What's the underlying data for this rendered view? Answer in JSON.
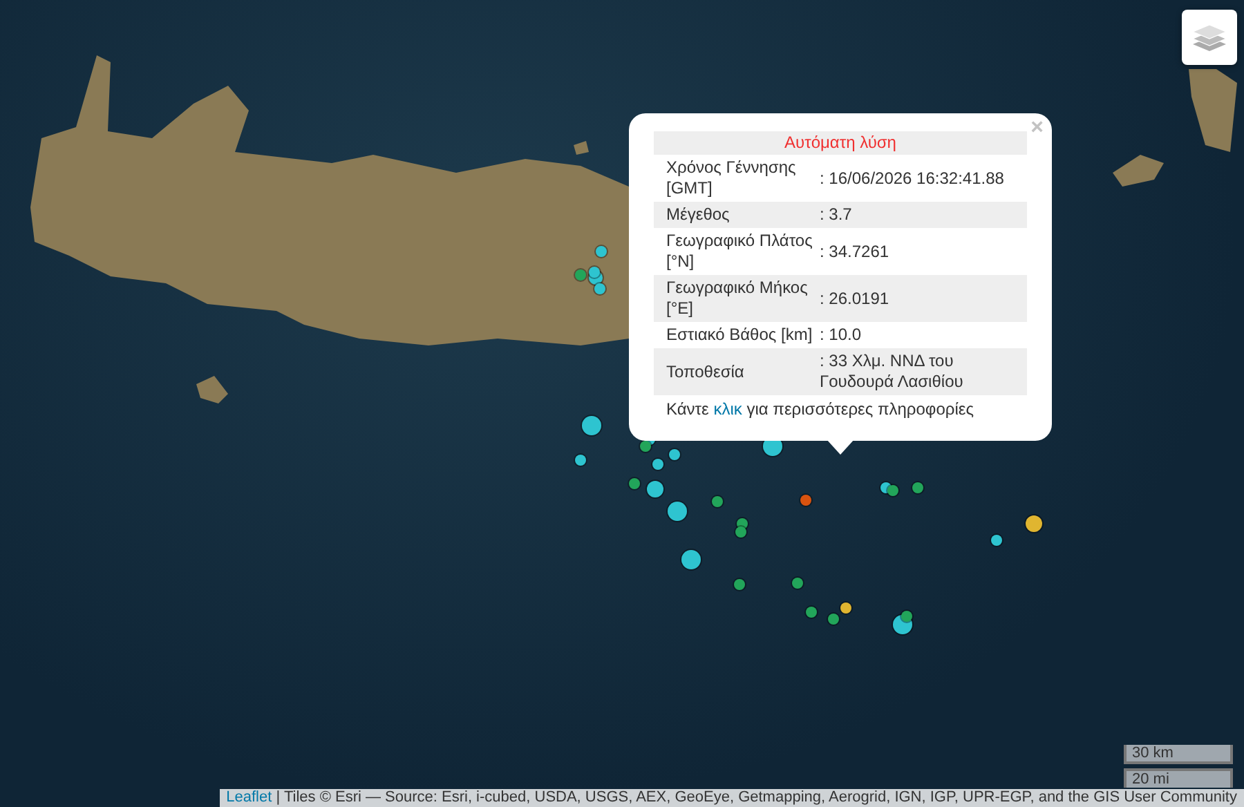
{
  "popup": {
    "title": "Αυτόματη λύση",
    "close": "×",
    "rows": [
      {
        "label": "Χρόνος Γέννησης [GMT]",
        "value": ": 16/06/2026 16:32:41.88"
      },
      {
        "label": "Μέγεθος",
        "value": ": 3.7"
      },
      {
        "label": "Γεωγραφικό Πλάτος [°N]",
        "value": ": 34.7261"
      },
      {
        "label": "Γεωγραφικό Μήκος [°E]",
        "value": ": 26.0191"
      },
      {
        "label": "Εστιακό Βάθος [km]",
        "value": ": 10.0"
      },
      {
        "label": "Τοποθεσία",
        "value": ": 33 Χλμ. ΝΝΔ του Γουδουρά Λασιθίου"
      }
    ],
    "footer": {
      "before": "Κάντε ",
      "link": "κλικ",
      "after": " για περισσότερες πληροφορίες"
    }
  },
  "markers": [
    {
      "color": "#2ec4d0"
    },
    {
      "color": "#2ec4d0"
    },
    {
      "color": "#2ec4d0"
    },
    {
      "color": "#2ec4d0"
    },
    {
      "color": "#2ec4d0"
    },
    {
      "color": "#2ec4d0"
    },
    {
      "color": "#2ec4d0"
    },
    {
      "color": "#2ec4d0"
    },
    {
      "color": "#2ec4d0"
    },
    {
      "color": "#2ec4d0"
    },
    {
      "color": "#2ec4d0"
    },
    {
      "color": "#2ec4d0"
    },
    {
      "color": "#2ec4d0"
    },
    {
      "color": "#2ec4d0"
    },
    {
      "color": "#2ec4d0"
    },
    {
      "color": "#2ec4d0"
    },
    {
      "color": "#22a55a"
    },
    {
      "color": "#22a55a"
    },
    {
      "color": "#22a55a"
    },
    {
      "color": "#22a55a"
    },
    {
      "color": "#22a55a"
    },
    {
      "color": "#22a55a"
    },
    {
      "color": "#22a55a"
    },
    {
      "color": "#22a55a"
    },
    {
      "color": "#22a55a"
    },
    {
      "color": "#22a55a"
    },
    {
      "color": "#22a55a"
    },
    {
      "color": "#22a55a"
    },
    {
      "color": "#22a55a"
    },
    {
      "color": "#d9530f"
    },
    {
      "color": "#e0b530"
    },
    {
      "color": "#e0b530"
    }
  ],
  "scale": [
    "30 km",
    "20 mi"
  ],
  "attribution": {
    "link": "Leaflet",
    "text": " | Tiles © Esri — Source: Esri, i-cubed, USDA, USGS, AEX, GeoEye, Getmapping, Aerogrid, IGN, IGP, UPR-EGP, and the GIS User Community"
  }
}
